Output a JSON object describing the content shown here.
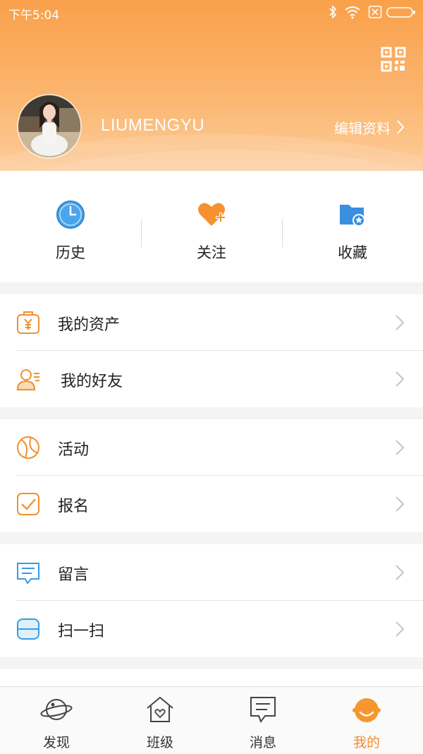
{
  "status_bar": {
    "time": "下午5:04"
  },
  "profile": {
    "username": "LIUMENGYU",
    "edit_label": "编辑资料"
  },
  "quick_actions": [
    {
      "label": "历史",
      "icon": "clock-icon"
    },
    {
      "label": "关注",
      "icon": "heart-plus-icon"
    },
    {
      "label": "收藏",
      "icon": "folder-star-icon"
    }
  ],
  "menu_groups": [
    [
      {
        "label": "我的资产",
        "icon": "wallet-icon"
      },
      {
        "label": "我的好友",
        "icon": "friends-icon"
      }
    ],
    [
      {
        "label": "活动",
        "icon": "ball-icon"
      },
      {
        "label": "报名",
        "icon": "checkbox-icon"
      }
    ],
    [
      {
        "label": "留言",
        "icon": "message-icon"
      },
      {
        "label": "扫一扫",
        "icon": "scan-icon"
      }
    ]
  ],
  "tabs": [
    {
      "label": "发现",
      "icon": "planet-icon",
      "active": false
    },
    {
      "label": "班级",
      "icon": "house-heart-icon",
      "active": false
    },
    {
      "label": "消息",
      "icon": "chat-icon",
      "active": false
    },
    {
      "label": "我的",
      "icon": "smiley-icon",
      "active": true
    }
  ],
  "colors": {
    "header_orange": "#f9a04a",
    "accent_orange": "#f38b2d",
    "icon_blue": "#3a9be3"
  }
}
